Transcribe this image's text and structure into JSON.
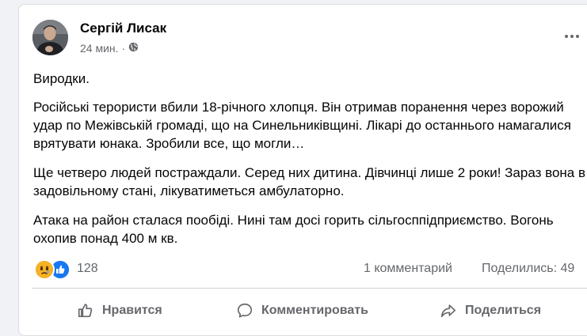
{
  "post": {
    "author": "Сергій Лисак",
    "time": "24 мин.",
    "audience_icon": "globe-icon",
    "paragraphs": [
      "Виродки.",
      "Російські терористи вбили 18-річного хлопця. Він отримав поранення через ворожий удар по Межівській громаді, що на Синельниківщині. Лікарі до останнього намагалися врятувати юнака. Зробили все, що могли…",
      "Ще четверо людей постраждали. Серед них дитина. Дівчинці лише 2 роки! Зараз вона в задовільному стані, лікуватиметься амбулаторно.",
      "Атака на район сталася пообіді. Нині там досі горить сільгосппідприємство. Вогонь охопив понад 400 м кв."
    ]
  },
  "stats": {
    "reaction_icons": [
      "sad-reaction-icon",
      "like-reaction-icon"
    ],
    "reaction_count": "128",
    "comments": "1 комментарий",
    "shares": "Поделились: 49"
  },
  "actions": {
    "like": "Нравится",
    "comment": "Комментировать",
    "share": "Поделиться"
  },
  "colors": {
    "background": "#f0f2f5",
    "card": "#ffffff",
    "secondary_text": "#65676b",
    "like_blue": "#1877f2",
    "sad_yellow": "#f7b125"
  }
}
